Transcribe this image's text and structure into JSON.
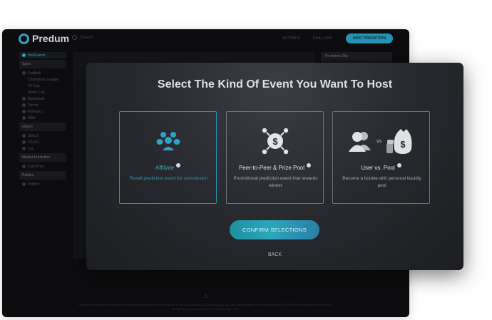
{
  "app": {
    "logo_text": "Predum",
    "search_placeholder": "Search",
    "top_links": [
      "SETTINGS",
      "DUAL, ENG"
    ],
    "host_button": "HOST PREDICTION",
    "sidebar": {
      "top_item": "Hot Events",
      "sections": [
        {
          "heading": "Sport",
          "items": [
            {
              "label": "Football"
            },
            {
              "label": "Champions League",
              "sub": true
            },
            {
              "label": "FA Cup",
              "sub": true
            },
            {
              "label": "World Cup",
              "sub": true
            },
            {
              "label": "Basketball"
            },
            {
              "label": "Tennis"
            },
            {
              "label": "Formula 1"
            },
            {
              "label": "NBA"
            }
          ]
        },
        {
          "heading": "eSport",
          "items": [
            {
              "label": "Dota 2"
            },
            {
              "label": "CS:GO"
            },
            {
              "label": "LoL"
            }
          ]
        },
        {
          "heading": "Market Prediction",
          "items": [
            {
              "label": "Coin Price"
            }
          ]
        },
        {
          "heading": "Politics",
          "items": [
            {
              "label": "Politics"
            }
          ]
        }
      ]
    },
    "right_panel_title": "Prediction Slip",
    "footer_text": "All bettors must confirm the wagering and/or gambling regulations that are applicable in their local jurisdiction (as gambling laws may vary in different states, countries and provinces). PDUM must not proceed or endorse any form of wagering or gambling to users under the age of 18."
  },
  "modal": {
    "title": "Select The Kind Of Event You Want To Host",
    "options": [
      {
        "title": "Affiliate",
        "description": "Resell prediction event for commission",
        "icon": "group-icon",
        "selected": true
      },
      {
        "title": "Peer-to-Peer & Prize Pool",
        "description": "Promotional prediction event that rewards winner",
        "icon": "coin-network-icon",
        "selected": false
      },
      {
        "title": "User vs. Pool",
        "description": "Become a bookie with personal liquidty pool",
        "icon": "users-vs-moneybag-icon",
        "vs_text": "vs",
        "selected": false
      }
    ],
    "confirm_button": "CONFIRM SELECTIONS",
    "back_link": "BACK"
  },
  "colors": {
    "accent": "#2f9fc0",
    "modal_bg": "#26282d",
    "app_bg": "#0d0d0f"
  }
}
